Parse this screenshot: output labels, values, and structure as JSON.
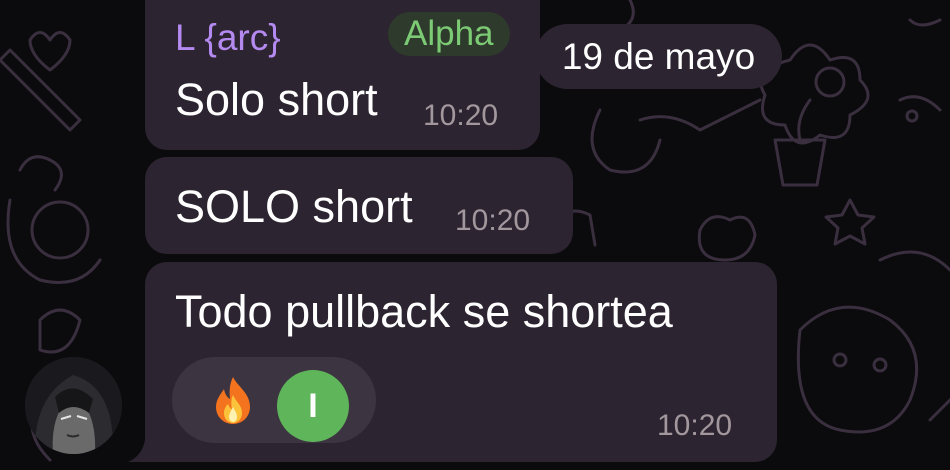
{
  "date_pill": "19 de mayo",
  "messages": [
    {
      "sender": "L {arc}",
      "role_badge": "Alpha",
      "text": "Solo short",
      "time": "10:20"
    },
    {
      "text": "SOLO short",
      "time": "10:20"
    },
    {
      "text": "Todo pullback se shortea",
      "time": "10:20",
      "reactions": {
        "emoji_icon": "fire-emoji",
        "reactor_initial": "I",
        "reactor_avatar_color": "#5fb55a"
      }
    }
  ],
  "colors": {
    "bubble": "#2c2430",
    "sender_name": "#b48af0",
    "badge_text": "#7ccb74",
    "timestamp": "#a3979e"
  },
  "icons": {
    "sender_avatar": "dark-hooded-portrait-avatar"
  }
}
